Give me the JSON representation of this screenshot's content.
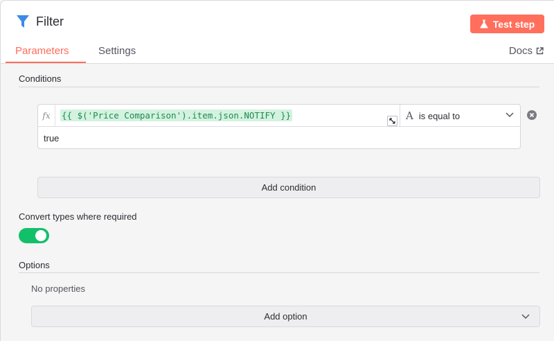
{
  "header": {
    "title": "Filter",
    "test_button_label": "Test step"
  },
  "tabs": {
    "parameters": "Parameters",
    "settings": "Settings",
    "docs": "Docs"
  },
  "conditions": {
    "section_title": "Conditions",
    "items": [
      {
        "fx_label": "fx",
        "left_value": "{{ $('Price Comparison').item.json.NOTIFY }}",
        "operator_type_icon": "A",
        "operator": "is equal to",
        "right_value": "true"
      }
    ],
    "add_button_label": "Add condition"
  },
  "convert_types": {
    "label": "Convert types where required",
    "enabled": true
  },
  "options": {
    "section_title": "Options",
    "empty_text": "No properties",
    "add_button_label": "Add option"
  },
  "colors": {
    "accent": "#ff6d5a",
    "test_button": "#ff6f5c",
    "toggle_on": "#13c06a",
    "filter_icon": "#3b8be6",
    "expression_text": "#1e8b4f",
    "expression_bg": "#d3f2e0"
  }
}
